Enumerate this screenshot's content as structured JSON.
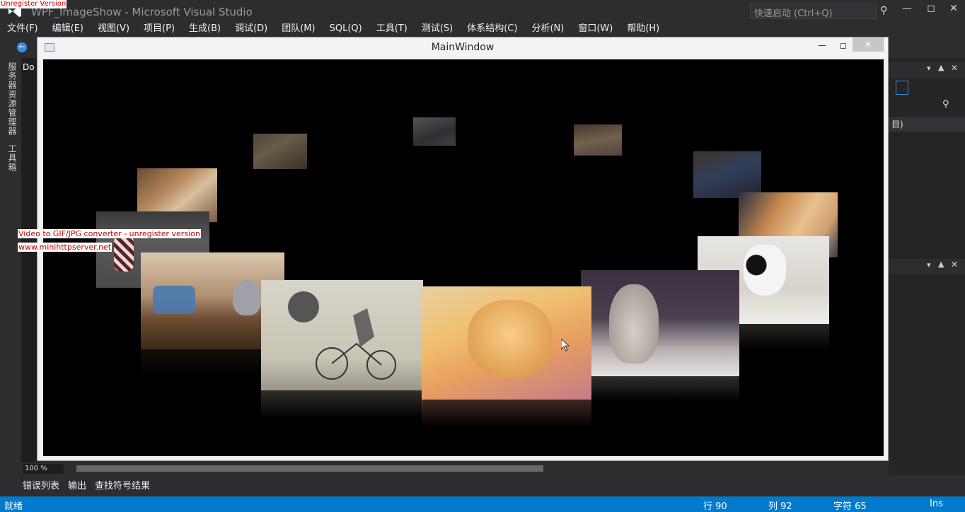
{
  "watermarks": {
    "unreg": "Unregister Version",
    "converter": "Video to GIF/JPG converter - unregister version",
    "site": "www.minihttpserver.net"
  },
  "vs": {
    "title": "WPF_ImageShow - Microsoft Visual Studio",
    "quick_launch": "快速启动 (Ctrl+Q)"
  },
  "menu": [
    "文件(F)",
    "编辑(E)",
    "视图(V)",
    "项目(P)",
    "生成(B)",
    "调试(D)",
    "团队(M)",
    "SQL(Q)",
    "工具(T)",
    "测试(S)",
    "体系结构(C)",
    "分析(N)",
    "窗口(W)",
    "帮助(H)"
  ],
  "side_tabs": [
    "服务器资源管理器",
    "工具箱"
  ],
  "doc_tab": "Do",
  "right_panel_label": "目)",
  "zoom": "100 %",
  "bottom_tabs": [
    "错误列表",
    "输出",
    "查找符号结果"
  ],
  "status": {
    "ready": "就绪",
    "line": "行 90",
    "col": "列 92",
    "char": "字符 65",
    "mode": "Ins"
  },
  "main_window": {
    "title": "MainWindow"
  },
  "photos": [
    {
      "name": "photo-cat-white-small",
      "caption": ""
    },
    {
      "name": "photo-cat-lying",
      "caption": ""
    },
    {
      "name": "photo-cats-group",
      "caption": ""
    },
    {
      "name": "photo-kitten-sleeping",
      "caption": ""
    },
    {
      "name": "photo-cat-blue-hat",
      "caption": ""
    },
    {
      "name": "photo-cats-cuddling",
      "caption": ""
    },
    {
      "name": "photo-cat-sweater",
      "caption": ""
    },
    {
      "name": "photo-kitten-shoes",
      "caption": ""
    },
    {
      "name": "photo-cat-bike-sketch",
      "caption": ""
    },
    {
      "name": "photo-orange-kitten",
      "caption": ""
    },
    {
      "name": "photo-bunny",
      "caption": ""
    },
    {
      "name": "photo-french-bulldog-puppy",
      "caption": ""
    }
  ],
  "colors": {
    "vs_bg": "#2d2d30",
    "status_blue": "#007acc",
    "canvas": "#000000"
  }
}
